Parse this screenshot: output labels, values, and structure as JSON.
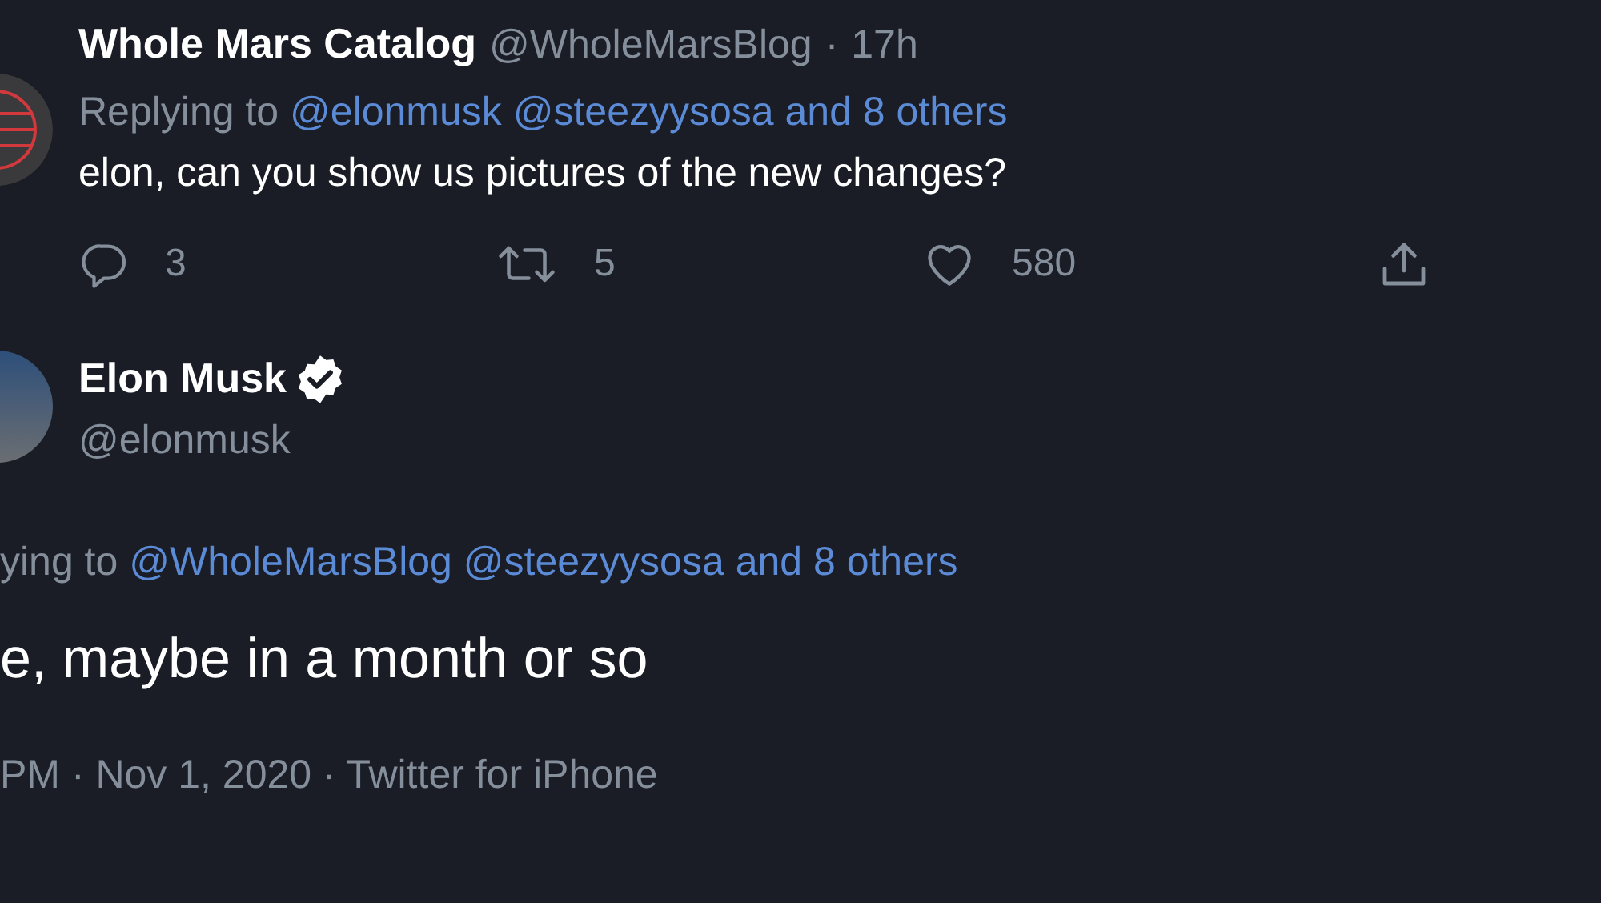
{
  "tweets": [
    {
      "kind": "reply",
      "name": "Whole Mars Catalog",
      "verified": false,
      "handle": "@WholeMarsBlog",
      "separator": "·",
      "time": "17h",
      "replying": {
        "prefix": "Replying to",
        "links": [
          "@elonmusk",
          "@steezyysosa",
          "and 8 others"
        ]
      },
      "text": "elon, can you show us pictures of the new changes?",
      "actions": [
        {
          "kind": "reply",
          "count": "3"
        },
        {
          "kind": "retweet",
          "count": "5"
        },
        {
          "kind": "like",
          "count": "580"
        },
        {
          "kind": "share"
        }
      ]
    },
    {
      "kind": "focused",
      "name": "Elon Musk",
      "verified": true,
      "handle": "@elonmusk",
      "replying": {
        "prefix": "ying to",
        "links": [
          "@WholeMarsBlog",
          "@steezyysosa",
          "and 8 others"
        ]
      },
      "text": "e, maybe in a month or so",
      "meta": "PM · Nov 1, 2020 · Twitter for iPhone"
    }
  ]
}
